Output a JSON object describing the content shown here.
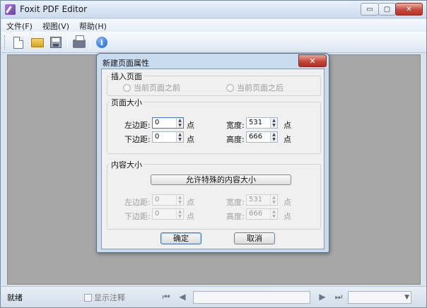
{
  "app": {
    "title": "Foxit PDF Editor"
  },
  "window_controls": {
    "minimize": "▭",
    "maximize": "▢",
    "close": "✕"
  },
  "menu": [
    {
      "label": "文件(F)"
    },
    {
      "label": "视图(V)"
    },
    {
      "label": "帮助(H)"
    }
  ],
  "toolbar": {
    "icons": [
      "new-document-icon",
      "open-folder-icon",
      "save-icon",
      "print-icon",
      "info-icon"
    ],
    "info_glyph": "i"
  },
  "dialog": {
    "title": "新建页面属性",
    "close_glyph": "✕",
    "insert_group": {
      "label": "插入页面",
      "option_before": "当前页面之前",
      "option_after": "当前页面之后"
    },
    "page_size_group": {
      "label": "页面大小",
      "left_margin_label": "左边距:",
      "left_margin_value": "0",
      "bottom_margin_label": "下边距:",
      "bottom_margin_value": "0",
      "unit": "点",
      "width_label": "宽度:",
      "width_value": "531",
      "height_label": "高度:",
      "height_value": "666"
    },
    "content_size_group": {
      "label": "内容大小",
      "allow_button": "允许特殊的内容大小",
      "left_margin_label": "左边距:",
      "left_margin_value": "0",
      "bottom_margin_label": "下边距:",
      "bottom_margin_value": "0",
      "unit": "点",
      "width_label": "宽度:",
      "width_value": "531",
      "height_label": "高度:",
      "height_value": "666"
    },
    "ok_button": "确定",
    "cancel_button": "取消"
  },
  "status": {
    "text": "就绪",
    "show_annotations": "显示注释",
    "nav": {
      "first": "⏮",
      "prev": "◀",
      "next": "▶",
      "last": "⏭"
    }
  }
}
